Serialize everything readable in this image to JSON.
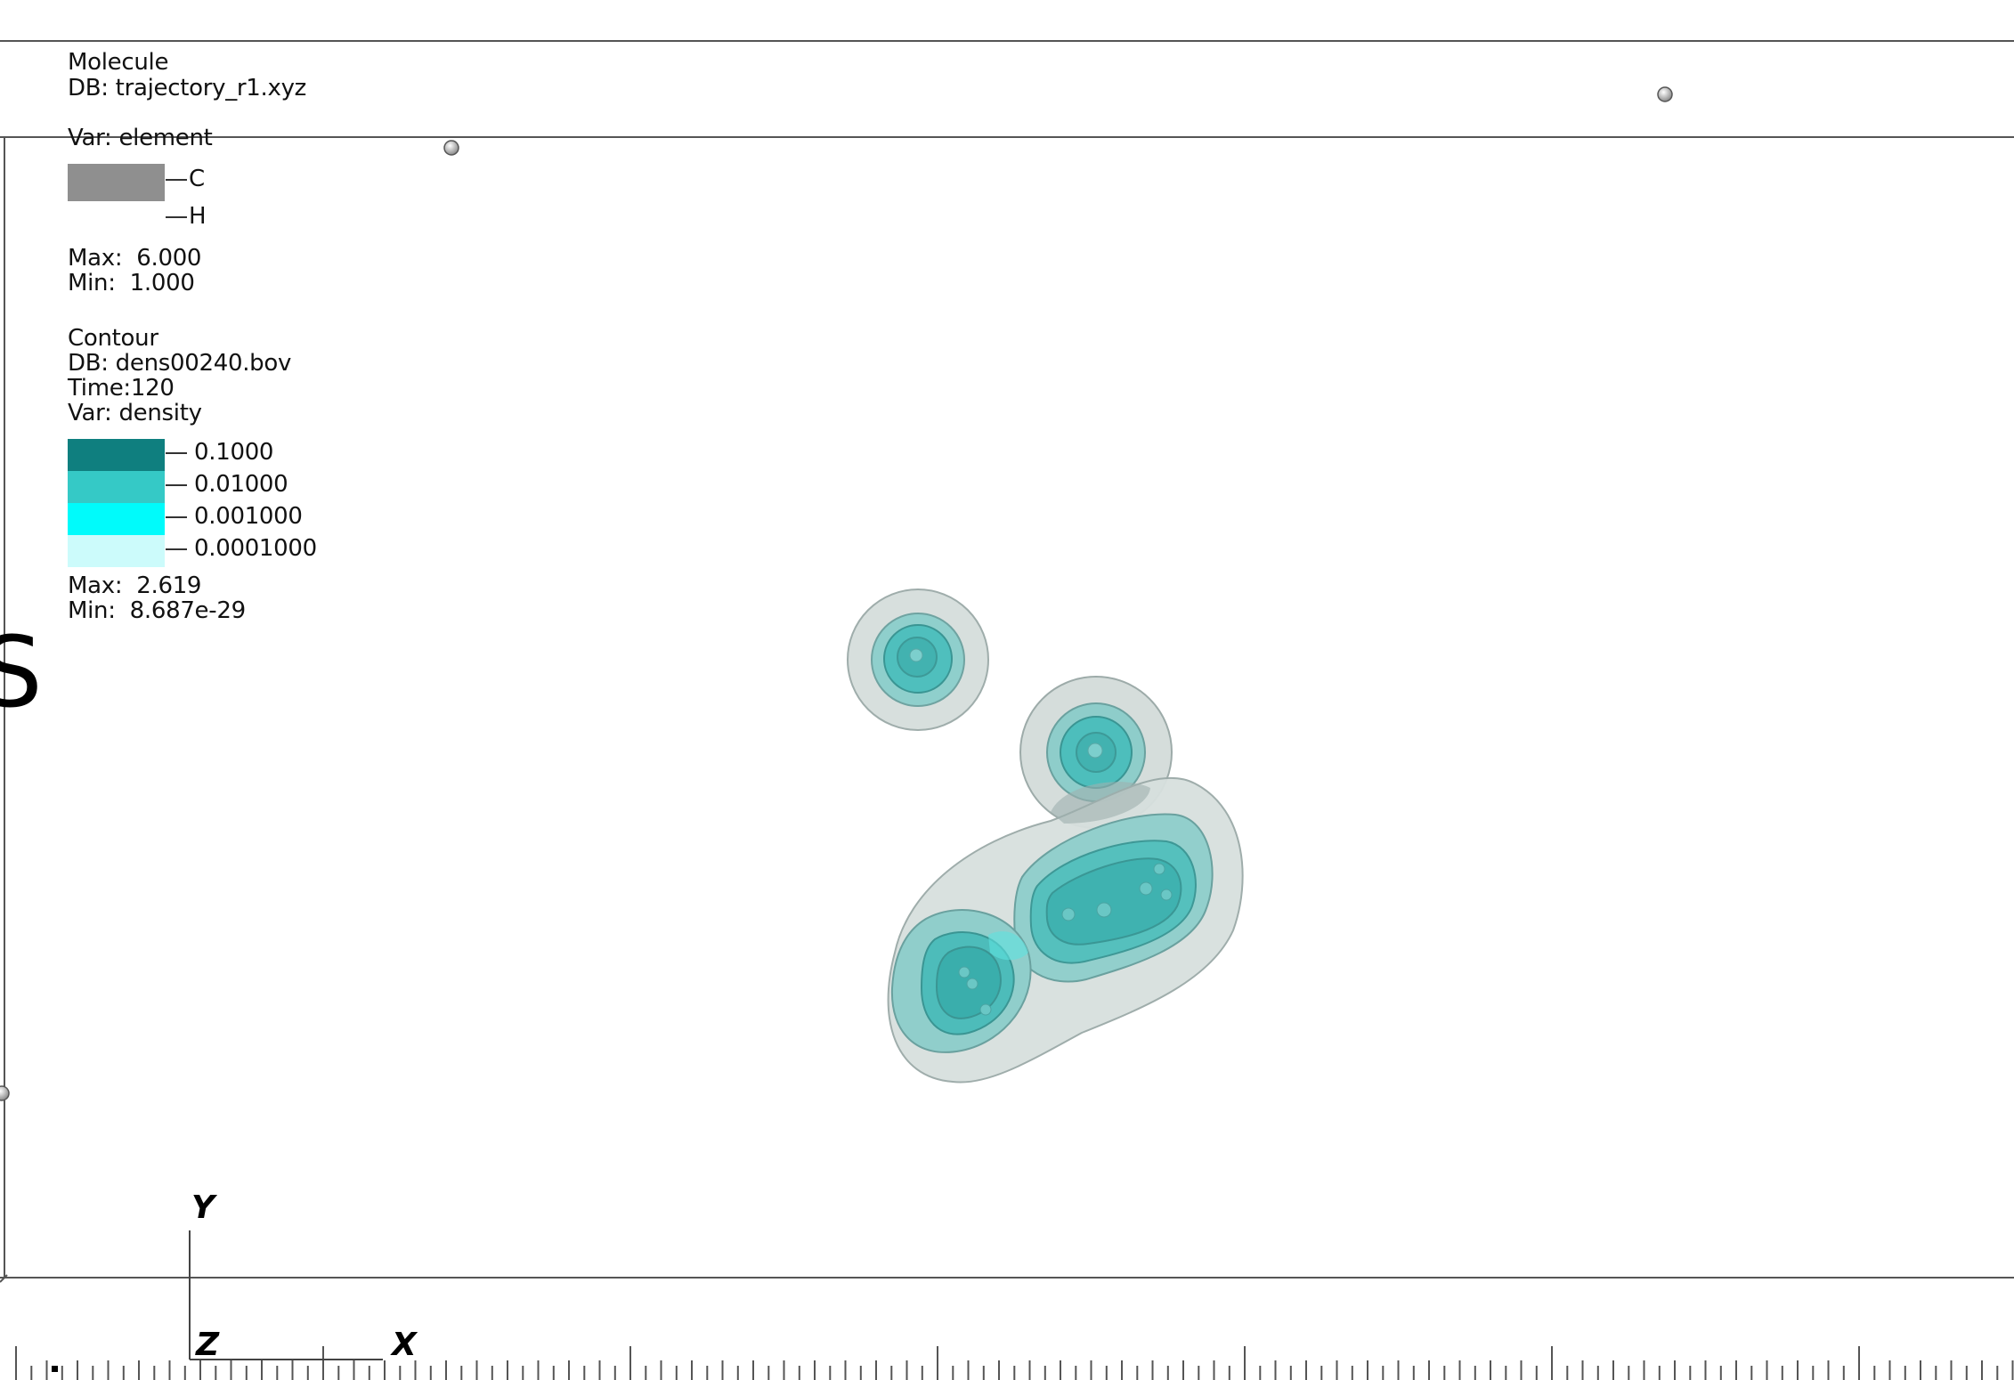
{
  "legend_molecule": {
    "plot_name": "Molecule",
    "db": "DB: trajectory_r1.xyz",
    "var": "Var: element",
    "entries": [
      "C",
      "H"
    ],
    "max": "Max:  6.000",
    "min": "Min:  1.000",
    "swatch_color": "#8f8f8f"
  },
  "legend_contour": {
    "plot_name": "Contour",
    "db": "DB: dens00240.bov",
    "time": "Time:120",
    "var": "Var: density",
    "levels": [
      {
        "label": "0.1000",
        "color": "#0f7f7f"
      },
      {
        "label": "0.01000",
        "color": "#35c9c6"
      },
      {
        "label": "0.001000",
        "color": "#00fbfb"
      },
      {
        "label": "0.0001000",
        "color": "#ccfbfb"
      }
    ],
    "max": "Max:  2.619",
    "min": "Min:  8.687e-29"
  },
  "clipped_label": "S",
  "triad": {
    "x": "X",
    "y": "Y",
    "z": "Z"
  },
  "colors": {
    "isosurface_outer": "#c7d3d1",
    "isosurface_mid": "#7fc9c6",
    "isosurface_inner": "#3fb7b6",
    "atom": "#bfbfbf",
    "frame_line": "#555555"
  }
}
